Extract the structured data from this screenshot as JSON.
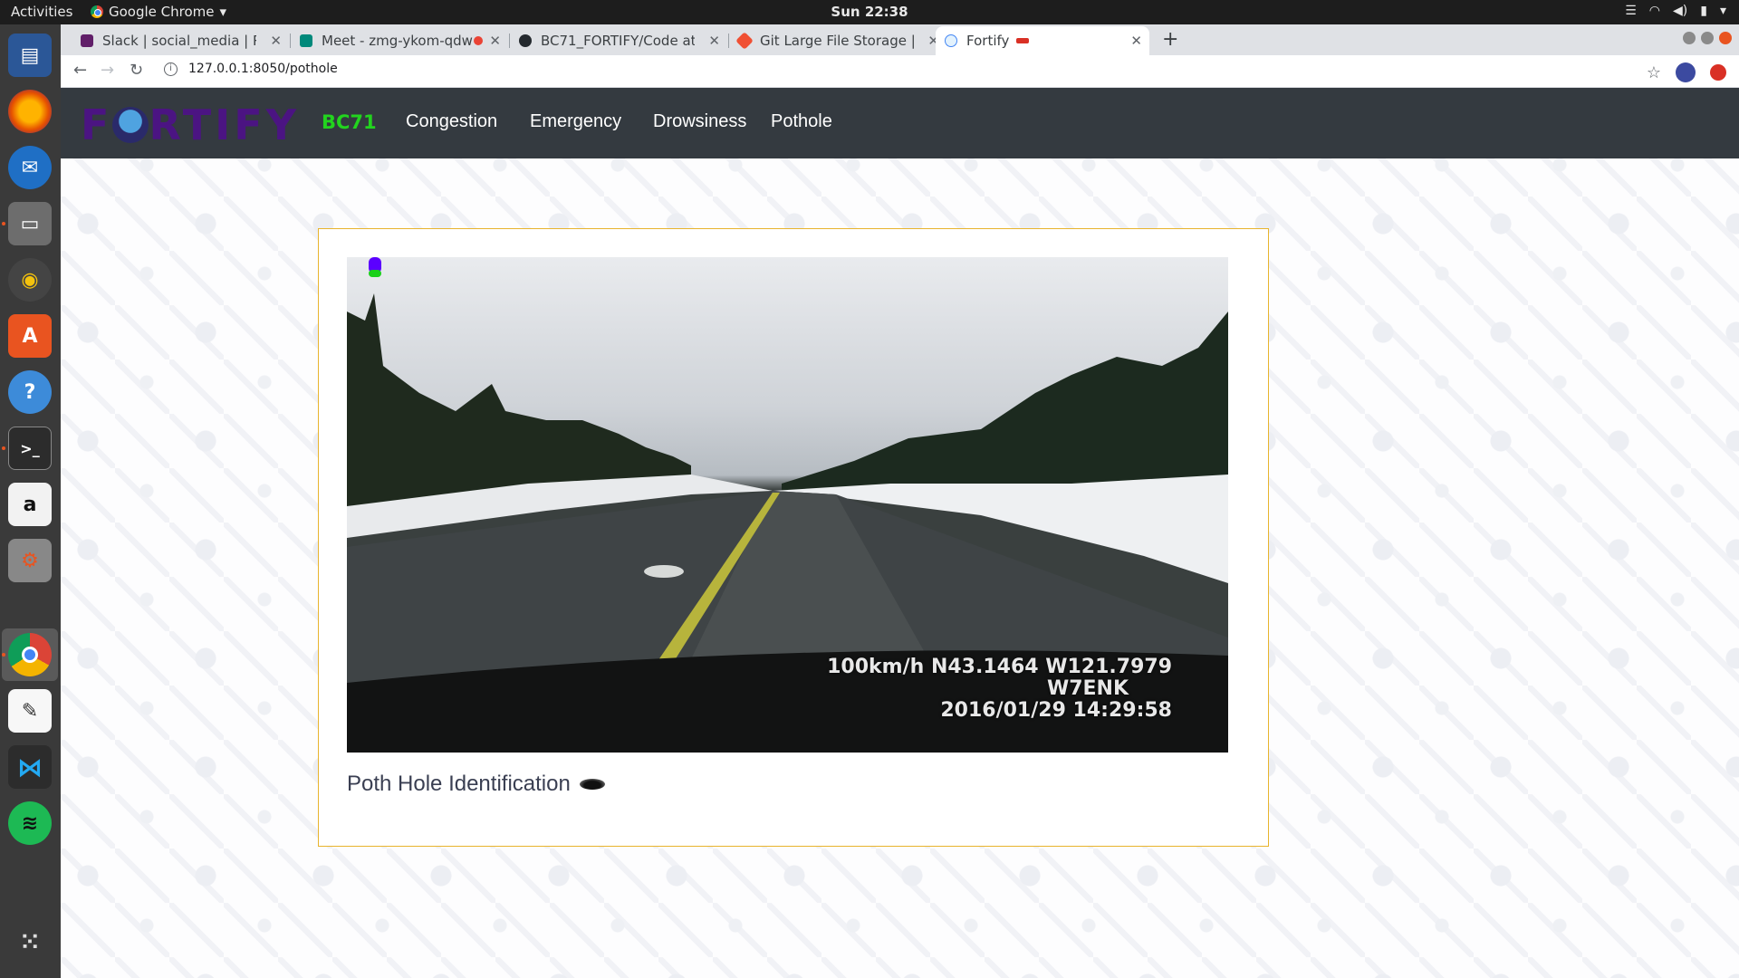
{
  "system": {
    "activities": "Activities",
    "app_name": "Google Chrome",
    "clock": "Sun 22:38"
  },
  "tabs": [
    {
      "title": "Slack | social_media | RKG",
      "color": "#611f69"
    },
    {
      "title": "Meet - zmg-ykom-qdw",
      "color": "#00897b"
    },
    {
      "title": "BC71_FORTIFY/Code at m",
      "color": "#24292e"
    },
    {
      "title": "Git Large File Storage | Gi",
      "color": "#f05033"
    },
    {
      "title": "Fortify",
      "color": "#4285f4"
    }
  ],
  "address_bar": {
    "url": "127.0.0.1:8050/pothole"
  },
  "navbar": {
    "logo_text_1": "F",
    "logo_text_2": "RTIFY",
    "brand": "BC71",
    "links": [
      "Congestion",
      "Emergency",
      "Drowsiness",
      "Pothole"
    ]
  },
  "video": {
    "speed_gps": "100km/h N43.1464 W121.7979",
    "callsign": "W7ENK",
    "datetime": "2016/01/29 14:29:58"
  },
  "caption": "Poth Hole Identification"
}
